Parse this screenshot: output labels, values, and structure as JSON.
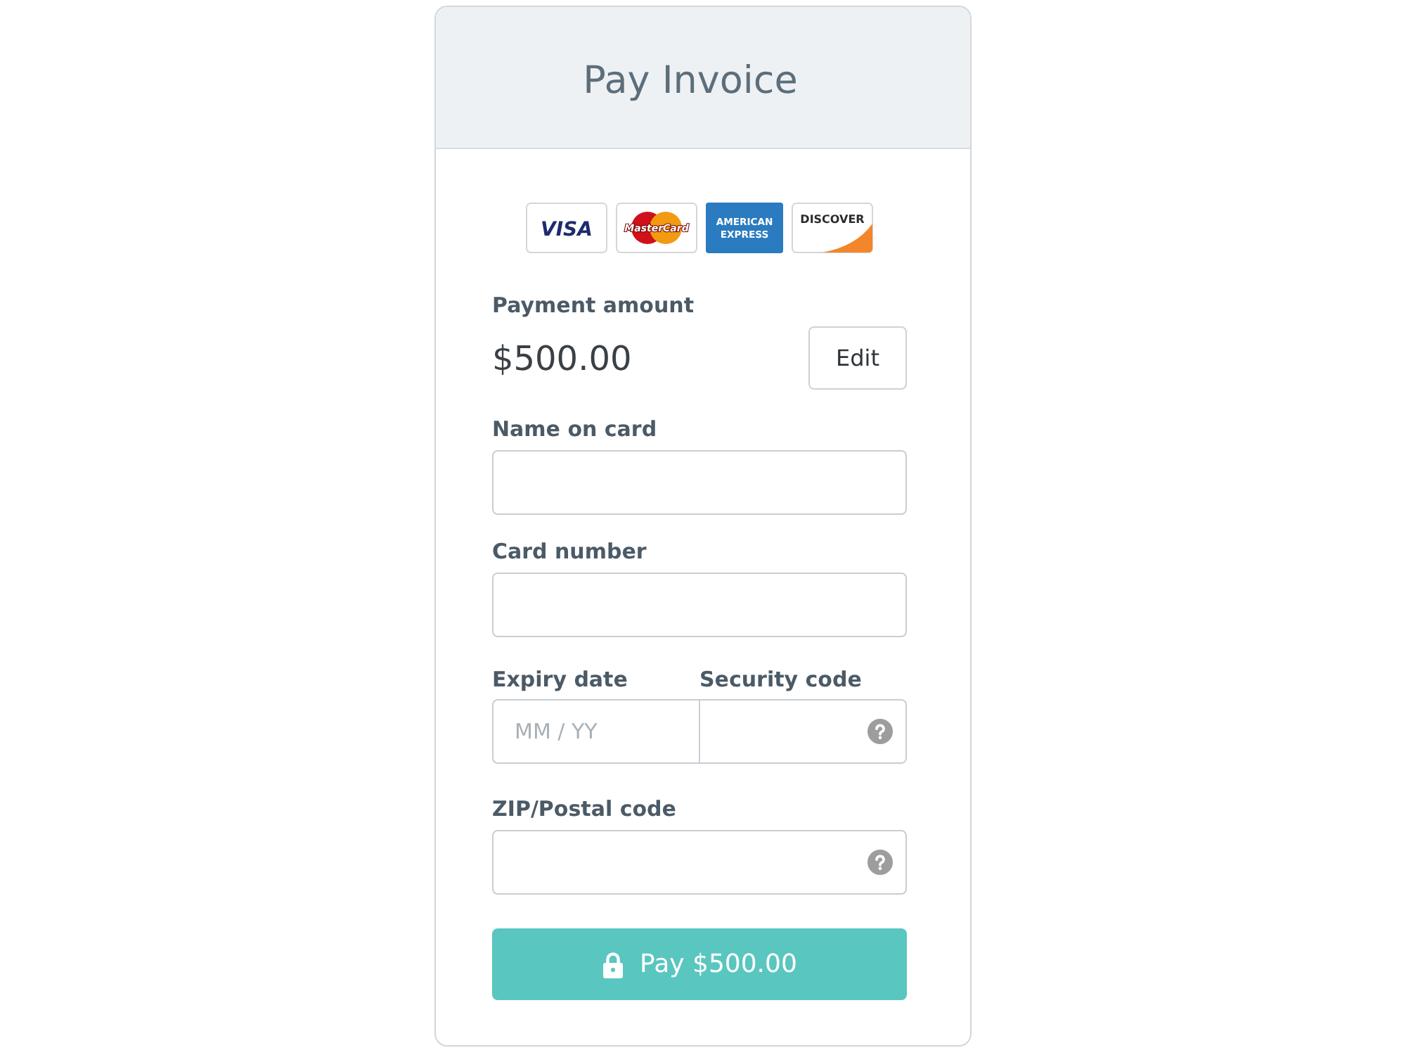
{
  "header": {
    "title": "Pay Invoice"
  },
  "card_brands": [
    {
      "kind": "visa",
      "lines": [
        "VISA"
      ]
    },
    {
      "kind": "mastercard",
      "lines": [
        "MasterCard"
      ]
    },
    {
      "kind": "amex",
      "lines": [
        "AMERICAN",
        "EXPRESS"
      ]
    },
    {
      "kind": "discover",
      "lines": [
        "DISCOVER"
      ]
    }
  ],
  "payment": {
    "label": "Payment amount",
    "amount": "$500.00",
    "edit_button": "Edit"
  },
  "fields": [
    {
      "kind": "single",
      "label": "Name on card",
      "help": false
    },
    {
      "kind": "single",
      "label": "Card number",
      "help": false
    },
    {
      "kind": "pair",
      "items": [
        {
          "label": "Expiry date",
          "placeholder": "MM / YY",
          "help": false
        },
        {
          "label": "Security code",
          "help": true
        }
      ]
    },
    {
      "kind": "single",
      "label": "ZIP/Postal code",
      "help": true
    }
  ],
  "pay_button": {
    "label": "Pay $500.00"
  }
}
